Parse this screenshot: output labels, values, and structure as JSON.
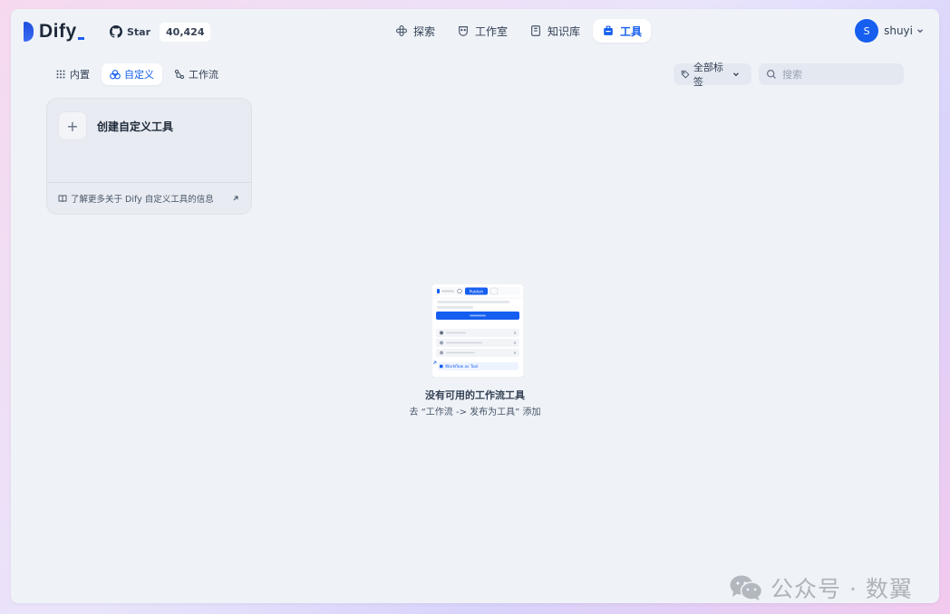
{
  "brand": {
    "name": "Dify"
  },
  "github": {
    "star_label": "Star",
    "star_count": "40,424"
  },
  "nav": {
    "explore": "探索",
    "studio": "工作室",
    "knowledge": "知识库",
    "tools": "工具"
  },
  "user": {
    "initial": "S",
    "name": "shuyi"
  },
  "tabs": {
    "builtin": "内置",
    "custom": "自定义",
    "workflow": "工作流"
  },
  "filter": {
    "tags_label": "全部标签"
  },
  "search": {
    "placeholder": "搜索"
  },
  "create_card": {
    "title": "创建自定义工具",
    "link_text": "了解更多关于 Dify 自定义工具的信息"
  },
  "empty": {
    "title": "没有可用的工作流工具",
    "hint": "去 “工作流 -> 发布为工具” 添加",
    "illustration_publish": "Publish",
    "illustration_item": "Workflow as Tool"
  },
  "watermark": {
    "text": "公众号 · 数翼"
  },
  "colors": {
    "accent": "#155eef",
    "background": "#eff3f8"
  }
}
